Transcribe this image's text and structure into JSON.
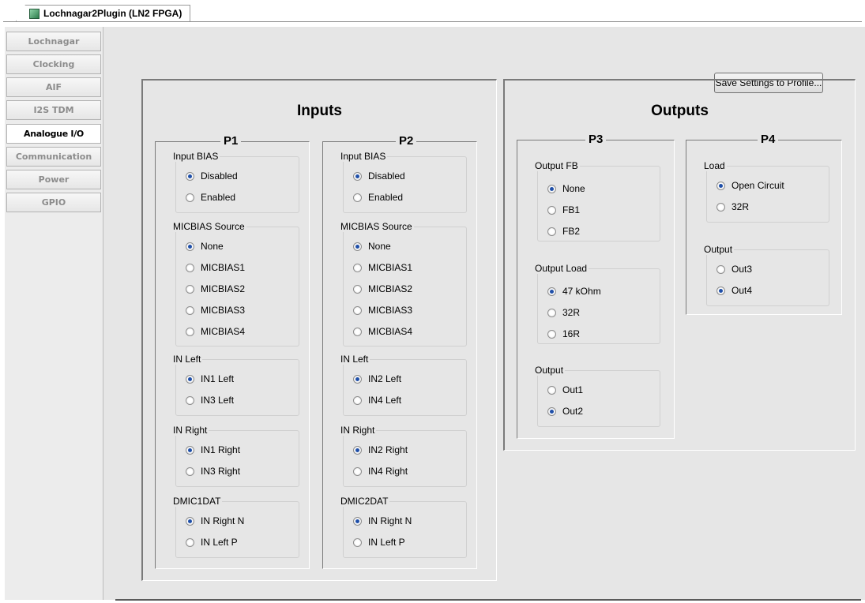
{
  "window": {
    "tab_title": "Lochnagar2Plugin (LN2 FPGA)"
  },
  "sidebar": {
    "items": [
      {
        "label": "Lochnagar",
        "active": false
      },
      {
        "label": "Clocking",
        "active": false
      },
      {
        "label": "AIF",
        "active": false
      },
      {
        "label": "I2S TDM",
        "active": false
      },
      {
        "label": "Analogue I/O",
        "active": true
      },
      {
        "label": "Communication",
        "active": false
      },
      {
        "label": "Power",
        "active": false
      },
      {
        "label": "GPIO",
        "active": false
      }
    ]
  },
  "toolbar": {
    "save_label": "Save Settings to Profile..."
  },
  "inputs": {
    "title": "Inputs",
    "p1": {
      "title": "P1",
      "input_bias": {
        "title": "Input BIAS",
        "options": [
          "Disabled",
          "Enabled"
        ],
        "selected": "Disabled"
      },
      "micbias_source": {
        "title": "MICBIAS Source",
        "options": [
          "None",
          "MICBIAS1",
          "MICBIAS2",
          "MICBIAS3",
          "MICBIAS4"
        ],
        "selected": "None"
      },
      "in_left": {
        "title": "IN Left",
        "options": [
          "IN1 Left",
          "IN3 Left"
        ],
        "selected": "IN1 Left"
      },
      "in_right": {
        "title": "IN Right",
        "options": [
          "IN1 Right",
          "IN3 Right"
        ],
        "selected": "IN1 Right"
      },
      "dmic": {
        "title": "DMIC1DAT",
        "options": [
          "IN Right N",
          "IN Left P"
        ],
        "selected": "IN Right N"
      }
    },
    "p2": {
      "title": "P2",
      "input_bias": {
        "title": "Input BIAS",
        "options": [
          "Disabled",
          "Enabled"
        ],
        "selected": "Disabled"
      },
      "micbias_source": {
        "title": "MICBIAS Source",
        "options": [
          "None",
          "MICBIAS1",
          "MICBIAS2",
          "MICBIAS3",
          "MICBIAS4"
        ],
        "selected": "None"
      },
      "in_left": {
        "title": "IN Left",
        "options": [
          "IN2 Left",
          "IN4 Left"
        ],
        "selected": "IN2 Left"
      },
      "in_right": {
        "title": "IN Right",
        "options": [
          "IN2 Right",
          "IN4 Right"
        ],
        "selected": "IN2 Right"
      },
      "dmic": {
        "title": "DMIC2DAT",
        "options": [
          "IN Right N",
          "IN Left P"
        ],
        "selected": "IN Right N"
      }
    }
  },
  "outputs": {
    "title": "Outputs",
    "p3": {
      "title": "P3",
      "output_fb": {
        "title": "Output FB",
        "options": [
          "None",
          "FB1",
          "FB2"
        ],
        "selected": "None"
      },
      "output_load": {
        "title": "Output Load",
        "options": [
          "47 kOhm",
          "32R",
          "16R"
        ],
        "selected": "47 kOhm"
      },
      "output": {
        "title": "Output",
        "options": [
          "Out1",
          "Out2"
        ],
        "selected": "Out2"
      }
    },
    "p4": {
      "title": "P4",
      "load": {
        "title": "Load",
        "options": [
          "Open Circuit",
          "32R"
        ],
        "selected": "Open Circuit"
      },
      "output": {
        "title": "Output",
        "options": [
          "Out3",
          "Out4"
        ],
        "selected": "Out4"
      }
    }
  },
  "colors": {
    "radio_selected": "#1f4fa8",
    "panel_bg": "#e6e6e6"
  }
}
